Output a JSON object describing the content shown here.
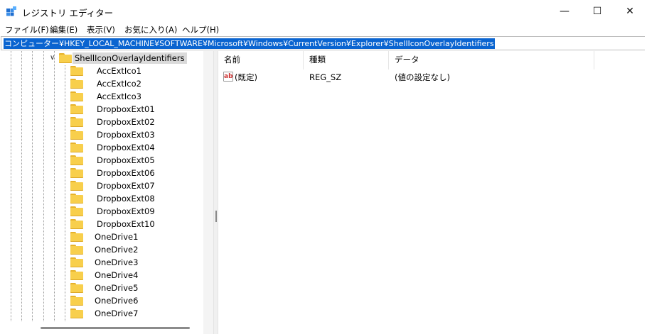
{
  "window": {
    "title": "レジストリ エディター",
    "minimize_glyph": "—",
    "maximize_glyph": "☐",
    "close_glyph": "✕"
  },
  "menu": [
    "ファイル(F)",
    "編集(E)",
    "表示(V)",
    "お気に入り(A)",
    "ヘルプ(H)"
  ],
  "address": "コンピューター¥HKEY_LOCAL_MACHINE¥SOFTWARE¥Microsoft¥Windows¥CurrentVersion¥Explorer¥ShellIconOverlayIdentifiers",
  "tree": {
    "selected": "ShellIconOverlayIdentifiers",
    "children": [
      "AccExtIco1",
      "AccExtIco2",
      "AccExtIco3",
      "DropboxExt01",
      "DropboxExt02",
      "DropboxExt03",
      "DropboxExt04",
      "DropboxExt05",
      "DropboxExt06",
      "DropboxExt07",
      "DropboxExt08",
      "DropboxExt09",
      "DropboxExt10",
      "OneDrive1",
      "OneDrive2",
      "OneDrive3",
      "OneDrive4",
      "OneDrive5",
      "OneDrive6",
      "OneDrive7"
    ]
  },
  "list": {
    "columns": [
      "名前",
      "種類",
      "データ"
    ],
    "rows": [
      {
        "icon": "string-value-icon",
        "name": "(既定)",
        "type": "REG_SZ",
        "data": "(値の設定なし)"
      }
    ]
  },
  "colors": {
    "selection": "#0a64d0",
    "folder": "#f8cf4c"
  }
}
